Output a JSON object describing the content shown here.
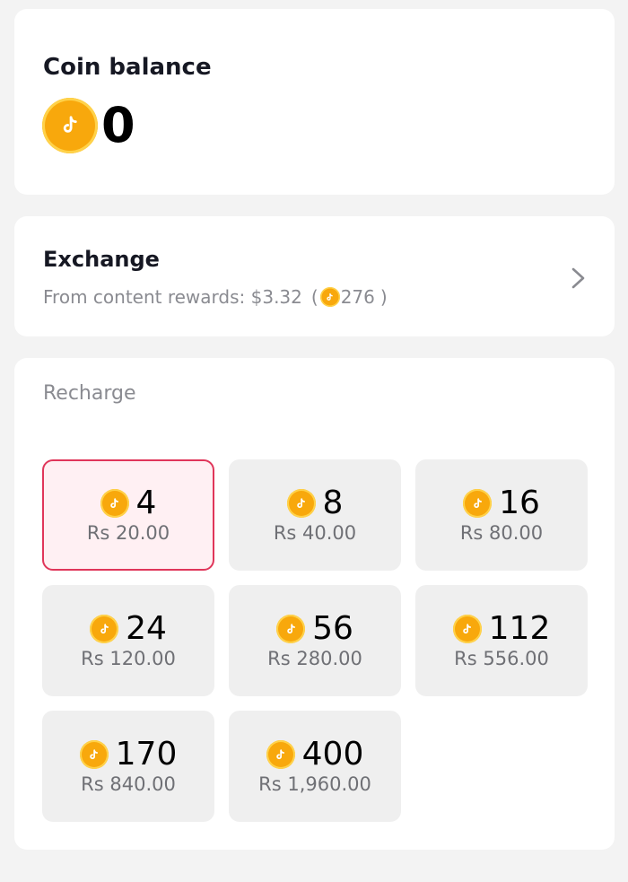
{
  "balance": {
    "title": "Coin balance",
    "value": "0"
  },
  "exchange": {
    "title": "Exchange",
    "subtitle": "From content rewards: $3.32",
    "coins": "276",
    "open_paren": "(",
    "close_paren": ")"
  },
  "recharge": {
    "title": "Recharge",
    "packages": [
      {
        "coins": "4",
        "price": "Rs 20.00",
        "selected": true
      },
      {
        "coins": "8",
        "price": "Rs 40.00",
        "selected": false
      },
      {
        "coins": "16",
        "price": "Rs 80.00",
        "selected": false
      },
      {
        "coins": "24",
        "price": "Rs 120.00",
        "selected": false
      },
      {
        "coins": "56",
        "price": "Rs 280.00",
        "selected": false
      },
      {
        "coins": "112",
        "price": "Rs 556.00",
        "selected": false
      },
      {
        "coins": "170",
        "price": "Rs 840.00",
        "selected": false
      },
      {
        "coins": "400",
        "price": "Rs 1,960.00",
        "selected": false
      }
    ]
  },
  "icons": {
    "coin": "tiktok-coin-icon",
    "chevron": "chevron-right-icon"
  },
  "colors": {
    "background": "#f3f3f3",
    "card": "#ffffff",
    "coin": "#f8a80c",
    "selected_border": "#e0365a",
    "selected_fill": "#fff0f3",
    "package_fill": "#efefef",
    "muted_text": "#8a8b91"
  }
}
